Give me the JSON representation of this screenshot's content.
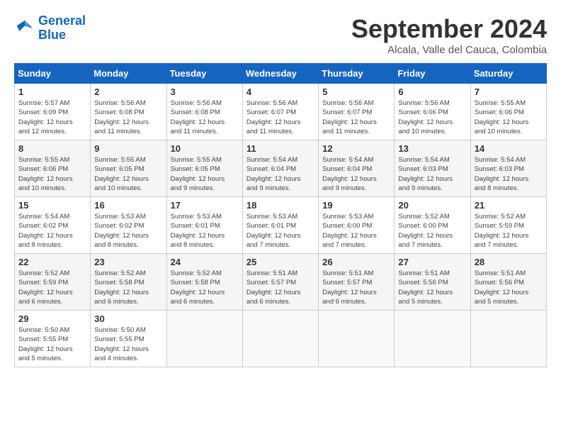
{
  "header": {
    "logo_line1": "General",
    "logo_line2": "Blue",
    "month_title": "September 2024",
    "location": "Alcala, Valle del Cauca, Colombia"
  },
  "calendar": {
    "days_of_week": [
      "Sunday",
      "Monday",
      "Tuesday",
      "Wednesday",
      "Thursday",
      "Friday",
      "Saturday"
    ],
    "weeks": [
      [
        {
          "day": "",
          "content": ""
        },
        {
          "day": "2",
          "content": "Sunrise: 5:56 AM\nSunset: 6:08 PM\nDaylight: 12 hours\nand 11 minutes."
        },
        {
          "day": "3",
          "content": "Sunrise: 5:56 AM\nSunset: 6:08 PM\nDaylight: 12 hours\nand 11 minutes."
        },
        {
          "day": "4",
          "content": "Sunrise: 5:56 AM\nSunset: 6:07 PM\nDaylight: 12 hours\nand 11 minutes."
        },
        {
          "day": "5",
          "content": "Sunrise: 5:56 AM\nSunset: 6:07 PM\nDaylight: 12 hours\nand 11 minutes."
        },
        {
          "day": "6",
          "content": "Sunrise: 5:56 AM\nSunset: 6:06 PM\nDaylight: 12 hours\nand 10 minutes."
        },
        {
          "day": "7",
          "content": "Sunrise: 5:55 AM\nSunset: 6:06 PM\nDaylight: 12 hours\nand 10 minutes."
        }
      ],
      [
        {
          "day": "1",
          "content": "Sunrise: 5:57 AM\nSunset: 6:09 PM\nDaylight: 12 hours\nand 12 minutes."
        },
        {
          "day": "9",
          "content": "Sunrise: 5:55 AM\nSunset: 6:05 PM\nDaylight: 12 hours\nand 10 minutes."
        },
        {
          "day": "10",
          "content": "Sunrise: 5:55 AM\nSunset: 6:05 PM\nDaylight: 12 hours\nand 9 minutes."
        },
        {
          "day": "11",
          "content": "Sunrise: 5:54 AM\nSunset: 6:04 PM\nDaylight: 12 hours\nand 9 minutes."
        },
        {
          "day": "12",
          "content": "Sunrise: 5:54 AM\nSunset: 6:04 PM\nDaylight: 12 hours\nand 9 minutes."
        },
        {
          "day": "13",
          "content": "Sunrise: 5:54 AM\nSunset: 6:03 PM\nDaylight: 12 hours\nand 9 minutes."
        },
        {
          "day": "14",
          "content": "Sunrise: 5:54 AM\nSunset: 6:03 PM\nDaylight: 12 hours\nand 8 minutes."
        }
      ],
      [
        {
          "day": "8",
          "content": "Sunrise: 5:55 AM\nSunset: 6:06 PM\nDaylight: 12 hours\nand 10 minutes."
        },
        {
          "day": "16",
          "content": "Sunrise: 5:53 AM\nSunset: 6:02 PM\nDaylight: 12 hours\nand 8 minutes."
        },
        {
          "day": "17",
          "content": "Sunrise: 5:53 AM\nSunset: 6:01 PM\nDaylight: 12 hours\nand 8 minutes."
        },
        {
          "day": "18",
          "content": "Sunrise: 5:53 AM\nSunset: 6:01 PM\nDaylight: 12 hours\nand 7 minutes."
        },
        {
          "day": "19",
          "content": "Sunrise: 5:53 AM\nSunset: 6:00 PM\nDaylight: 12 hours\nand 7 minutes."
        },
        {
          "day": "20",
          "content": "Sunrise: 5:52 AM\nSunset: 6:00 PM\nDaylight: 12 hours\nand 7 minutes."
        },
        {
          "day": "21",
          "content": "Sunrise: 5:52 AM\nSunset: 5:59 PM\nDaylight: 12 hours\nand 7 minutes."
        }
      ],
      [
        {
          "day": "15",
          "content": "Sunrise: 5:54 AM\nSunset: 6:02 PM\nDaylight: 12 hours\nand 8 minutes."
        },
        {
          "day": "23",
          "content": "Sunrise: 5:52 AM\nSunset: 5:58 PM\nDaylight: 12 hours\nand 6 minutes."
        },
        {
          "day": "24",
          "content": "Sunrise: 5:52 AM\nSunset: 5:58 PM\nDaylight: 12 hours\nand 6 minutes."
        },
        {
          "day": "25",
          "content": "Sunrise: 5:51 AM\nSunset: 5:57 PM\nDaylight: 12 hours\nand 6 minutes."
        },
        {
          "day": "26",
          "content": "Sunrise: 5:51 AM\nSunset: 5:57 PM\nDaylight: 12 hours\nand 6 minutes."
        },
        {
          "day": "27",
          "content": "Sunrise: 5:51 AM\nSunset: 5:56 PM\nDaylight: 12 hours\nand 5 minutes."
        },
        {
          "day": "28",
          "content": "Sunrise: 5:51 AM\nSunset: 5:56 PM\nDaylight: 12 hours\nand 5 minutes."
        }
      ],
      [
        {
          "day": "22",
          "content": "Sunrise: 5:52 AM\nSunset: 5:59 PM\nDaylight: 12 hours\nand 6 minutes."
        },
        {
          "day": "30",
          "content": "Sunrise: 5:50 AM\nSunset: 5:55 PM\nDaylight: 12 hours\nand 4 minutes."
        },
        {
          "day": "",
          "content": ""
        },
        {
          "day": "",
          "content": ""
        },
        {
          "day": "",
          "content": ""
        },
        {
          "day": "",
          "content": ""
        },
        {
          "day": "",
          "content": ""
        }
      ],
      [
        {
          "day": "29",
          "content": "Sunrise: 5:50 AM\nSunset: 5:55 PM\nDaylight: 12 hours\nand 5 minutes."
        },
        {
          "day": "",
          "content": ""
        },
        {
          "day": "",
          "content": ""
        },
        {
          "day": "",
          "content": ""
        },
        {
          "day": "",
          "content": ""
        },
        {
          "day": "",
          "content": ""
        },
        {
          "day": "",
          "content": ""
        }
      ]
    ]
  }
}
